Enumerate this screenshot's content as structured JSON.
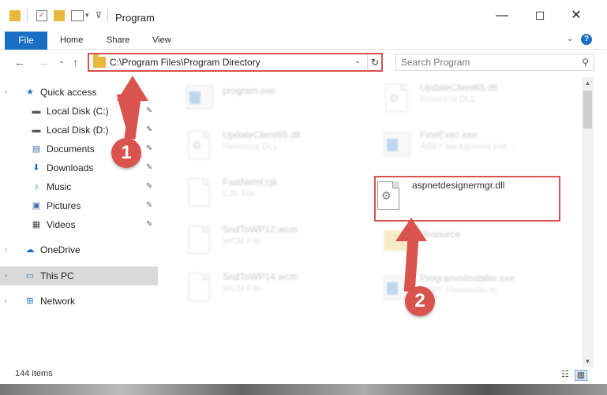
{
  "window": {
    "title": "Program",
    "minimize": "—",
    "maximize": "☐",
    "close": "✕"
  },
  "ribbon": {
    "file": "File",
    "home": "Home",
    "share": "Share",
    "view": "View",
    "help": "?"
  },
  "nav": {
    "back": "←",
    "forward": "→",
    "recent": "⌄",
    "up": "↑"
  },
  "address": {
    "path": "C:\\Program Files\\Program Directory",
    "dropdown": "⌄",
    "refresh": "↻"
  },
  "search": {
    "placeholder": "Search Program",
    "icon": "⚲"
  },
  "sidebar": {
    "items": [
      {
        "label": "Quick access",
        "icon": "★",
        "color": "#1a6fc4"
      },
      {
        "label": "Local Disk (C:)",
        "icon": "▬",
        "color": "#555"
      },
      {
        "label": "Local Disk (D:)",
        "icon": "▬",
        "color": "#555"
      },
      {
        "label": "Documents",
        "icon": "▤",
        "color": "#4a6fa5"
      },
      {
        "label": "Downloads",
        "icon": "⬇",
        "color": "#1a6fc4"
      },
      {
        "label": "Music",
        "icon": "♪",
        "color": "#1a6fc4"
      },
      {
        "label": "Pictures",
        "icon": "▣",
        "color": "#4a6fa5"
      },
      {
        "label": "Videos",
        "icon": "▦",
        "color": "#444"
      },
      {
        "label": "OneDrive",
        "icon": "☁",
        "color": "#1a6fc4"
      },
      {
        "label": "This PC",
        "icon": "▭",
        "color": "#1a6fc4"
      },
      {
        "label": "Network",
        "icon": "⊞",
        "color": "#1a6fc4"
      }
    ],
    "pin": "📌"
  },
  "files": [
    {
      "name": "program.exe",
      "type": ""
    },
    {
      "name": "UpdateClient65.dll",
      "type": "Resource DLL"
    },
    {
      "name": "UpdateClient65.dll",
      "type": "Resource DLL"
    },
    {
      "name": "FineExec.exe",
      "type": "ABBY background exe..."
    },
    {
      "name": "FastNeml.cjk",
      "type": "CJK File"
    },
    {
      "name": "aspnetdesignermgr.dll",
      "type": ""
    },
    {
      "name": "SndToWP12.wcm",
      "type": "WCM File"
    },
    {
      "name": "Resource",
      "type": ""
    },
    {
      "name": "SndToWP14.wcm",
      "type": "WCM File"
    },
    {
      "name": "ProgrammInstaller.exe",
      "type": "ABBY Finereader to..."
    }
  ],
  "status": {
    "count": "144 items"
  },
  "annotations": {
    "step1": "1",
    "step2": "2"
  },
  "colors": {
    "accent": "#1a6fc4",
    "highlight": "#d9534f"
  }
}
